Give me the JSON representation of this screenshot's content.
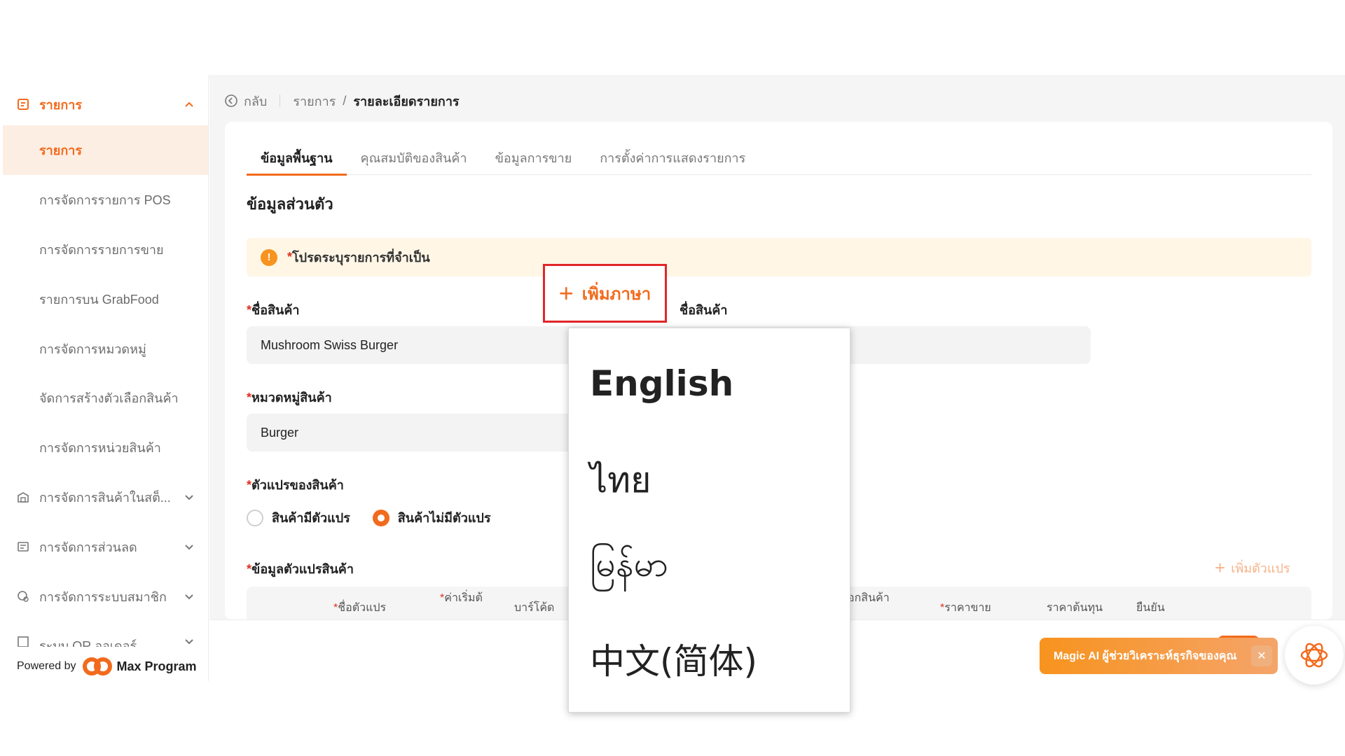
{
  "sidebar": {
    "group_label": "รายการ",
    "items": [
      {
        "label": "รายการ",
        "active": true
      },
      {
        "label": "การจัดการรายการ POS"
      },
      {
        "label": "การจัดการรายการขาย"
      },
      {
        "label": "รายการบน GrabFood"
      },
      {
        "label": "การจัดการหมวดหมู่"
      },
      {
        "label": "จัดการสร้างตัวเลือกสินค้า"
      },
      {
        "label": "การจัดการหน่วยสินค้า"
      }
    ],
    "collapsed_groups": [
      {
        "label": "การจัดการสินค้าในสต็...",
        "icon": "warehouse-icon"
      },
      {
        "label": "การจัดการส่วนลด",
        "icon": "discount-icon"
      },
      {
        "label": "การจัดการระบบสมาชิก",
        "icon": "member-icon"
      },
      {
        "label": "ระบบ QR ออเดอร์",
        "icon": "qr-icon"
      }
    ],
    "powered_prefix": "Powered by",
    "powered_brand": "Max Program"
  },
  "breadcrumb": {
    "back": "กลับ",
    "parent": "รายการ",
    "separator": "/",
    "current": "รายละเอียดรายการ"
  },
  "tabs": [
    {
      "label": "ข้อมูลพื้นฐาน",
      "active": true
    },
    {
      "label": "คุณสมบัติของสินค้า"
    },
    {
      "label": "ข้อมูลการขาย"
    },
    {
      "label": "การตั้งค่าการแสดงรายการ"
    }
  ],
  "section_title": "ข้อมูลส่วนตัว",
  "notice": {
    "required_mark": "*",
    "text": "โปรดระบุรายการที่จำเป็น",
    "icon_text": "!"
  },
  "form": {
    "product_name_label": "ชื่อสินค้า",
    "product_name_value": "Mushroom Swiss Burger",
    "second_name_label": "ชื่อสินค้า",
    "category_label": "หมวดหมู่สินค้า",
    "category_value": "Burger",
    "variant_label": "ตัวแปรของสินค้า",
    "variant_options": [
      {
        "label": "สินค้ามีตัวแปร",
        "selected": false
      },
      {
        "label": "สินค้าไม่มีตัวแปร",
        "selected": true
      }
    ],
    "variant_info_label": "ข้อมูลตัวแปรสินค้า",
    "add_variant": "เพิ่มตัวแปร",
    "required_mark": "*"
  },
  "table": {
    "headers": [
      "ชื่อตัวแปร",
      "ค่าเริ่มต้",
      "บาร์โค้ด",
      "อกสินค้า",
      "ราคาขาย",
      "ราคาต้นทุน",
      "ยืนยัน"
    ]
  },
  "add_language": {
    "plus": "+",
    "label": "เพิ่มภาษา"
  },
  "language_menu": [
    "English",
    "ไทย",
    "မြန်မာ",
    "中文(简体)"
  ],
  "magic_ai": {
    "text": "Magic AI ผู้ช่วยวิเคราะห์ธุรกิจของคุณ",
    "close": "✕"
  },
  "colors": {
    "accent": "#f26b1d",
    "highlight_border": "#e0262a",
    "notice_bg": "#fff6e6"
  }
}
